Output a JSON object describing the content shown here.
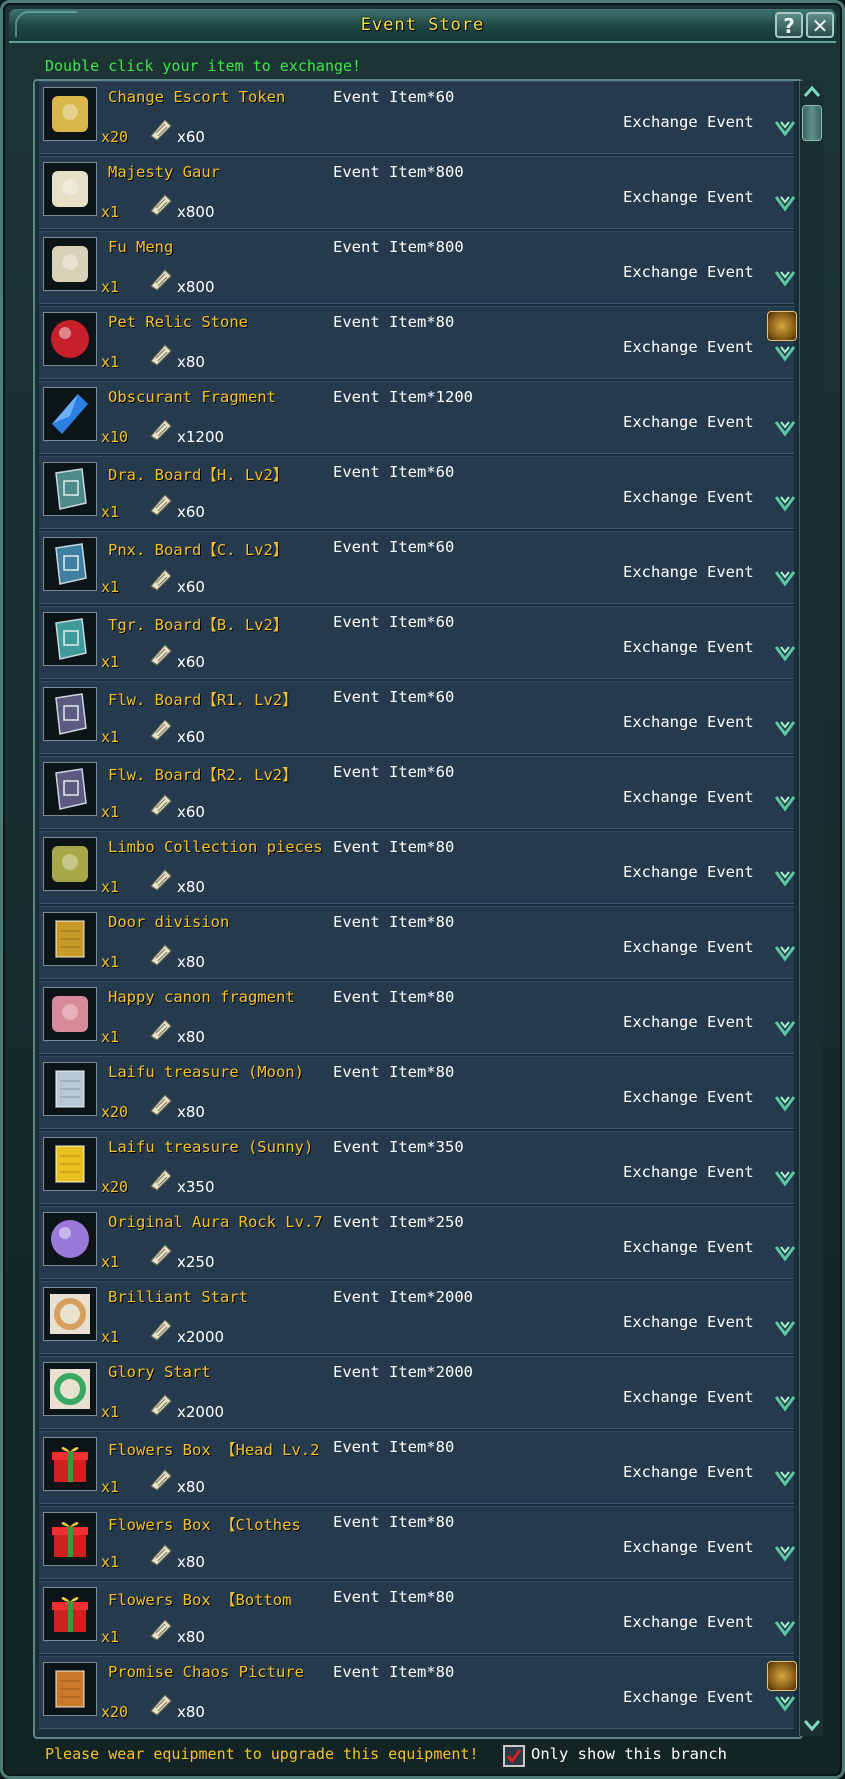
{
  "window": {
    "title": "Event Store",
    "help_label": "?",
    "close_label": "✕",
    "hint": "Double click your item to exchange!"
  },
  "items": [
    {
      "name": "Change Escort Token",
      "qty": "x20",
      "cost": "x60",
      "requirement": "Event Item*60",
      "exchange_label": "Exchange Event",
      "icon": "escort-token-icon",
      "color": "#d8b64a",
      "badge": false
    },
    {
      "name": "Majesty Gaur",
      "qty": "x1",
      "cost": "x800",
      "requirement": "Event Item*800",
      "exchange_label": "Exchange Event",
      "icon": "gaur-mount-icon",
      "color": "#e6e0c8",
      "badge": false
    },
    {
      "name": "Fu Meng",
      "qty": "x1",
      "cost": "x800",
      "requirement": "Event Item*800",
      "exchange_label": "Exchange Event",
      "icon": "fu-meng-mount-icon",
      "color": "#d9d2b8",
      "badge": false
    },
    {
      "name": "Pet Relic Stone",
      "qty": "x1",
      "cost": "x80",
      "requirement": "Event Item*80",
      "exchange_label": "Exchange Event",
      "icon": "relic-stone-icon",
      "color": "#c8202a",
      "badge": true
    },
    {
      "name": "Obscurant Fragment",
      "qty": "x10",
      "cost": "x1200",
      "requirement": "Event Item*1200",
      "exchange_label": "Exchange Event",
      "icon": "blue-crystal-icon",
      "color": "#2a7fe0",
      "badge": false
    },
    {
      "name": "Dra. Board【H. Lv2】",
      "qty": "x1",
      "cost": "x60",
      "requirement": "Event Item*60",
      "exchange_label": "Exchange Event",
      "icon": "dragon-board-icon",
      "color": "#4e8a8a",
      "badge": false
    },
    {
      "name": "Pnx. Board【C. Lv2】",
      "qty": "x1",
      "cost": "x60",
      "requirement": "Event Item*60",
      "exchange_label": "Exchange Event",
      "icon": "phoenix-board-icon",
      "color": "#3f7fa0",
      "badge": false
    },
    {
      "name": "Tgr. Board【B. Lv2】",
      "qty": "x1",
      "cost": "x60",
      "requirement": "Event Item*60",
      "exchange_label": "Exchange Event",
      "icon": "tiger-board-icon",
      "color": "#3f9a9a",
      "badge": false
    },
    {
      "name": "Flw. Board【R1. Lv2】",
      "qty": "x1",
      "cost": "x60",
      "requirement": "Event Item*60",
      "exchange_label": "Exchange Event",
      "icon": "flower-board-icon",
      "color": "#5c5a80",
      "badge": false
    },
    {
      "name": "Flw. Board【R2. Lv2】",
      "qty": "x1",
      "cost": "x60",
      "requirement": "Event Item*60",
      "exchange_label": "Exchange Event",
      "icon": "flower-board-icon",
      "color": "#5c5a80",
      "badge": false
    },
    {
      "name": "Limbo Collection pieces",
      "qty": "x1",
      "cost": "x80",
      "requirement": "Event Item*80",
      "exchange_label": "Exchange Event",
      "icon": "leaf-pieces-icon",
      "color": "#a8a84a",
      "badge": false
    },
    {
      "name": "Door division",
      "qty": "x1",
      "cost": "x80",
      "requirement": "Event Item*80",
      "exchange_label": "Exchange Event",
      "icon": "door-scroll-icon",
      "color": "#c89a2a",
      "badge": false
    },
    {
      "name": "Happy canon fragment",
      "qty": "x1",
      "cost": "x80",
      "requirement": "Event Item*80",
      "exchange_label": "Exchange Event",
      "icon": "pink-fragment-icon",
      "color": "#d88a9a",
      "badge": false
    },
    {
      "name": "Laifu treasure (Moon)",
      "qty": "x20",
      "cost": "x80",
      "requirement": "Event Item*80",
      "exchange_label": "Exchange Event",
      "icon": "moon-treasure-icon",
      "color": "#b8c8d8",
      "badge": false
    },
    {
      "name": "Laifu treasure (Sunny)",
      "qty": "x20",
      "cost": "x350",
      "requirement": "Event Item*350",
      "exchange_label": "Exchange Event",
      "icon": "sun-treasure-icon",
      "color": "#e8c020",
      "badge": false
    },
    {
      "name": "Original Aura Rock Lv.7",
      "qty": "x1",
      "cost": "x250",
      "requirement": "Event Item*250",
      "exchange_label": "Exchange Event",
      "icon": "aura-orb-icon",
      "color": "#9a7ad8",
      "badge": false
    },
    {
      "name": "Brilliant Start",
      "qty": "x1",
      "cost": "x2000",
      "requirement": "Event Item*2000",
      "exchange_label": "Exchange Event",
      "icon": "brilliant-ring-icon",
      "color": "#d8a060",
      "badge": false
    },
    {
      "name": "Glory Start",
      "qty": "x1",
      "cost": "x2000",
      "requirement": "Event Item*2000",
      "exchange_label": "Exchange Event",
      "icon": "glory-ring-icon",
      "color": "#3aa860",
      "badge": false
    },
    {
      "name": "Flowers Box 【Head Lv.2",
      "qty": "x1",
      "cost": "x80",
      "requirement": "Event Item*80",
      "exchange_label": "Exchange Event",
      "icon": "gift-box-icon",
      "color": "#d02020",
      "badge": false
    },
    {
      "name": "Flowers Box 【Clothes",
      "qty": "x1",
      "cost": "x80",
      "requirement": "Event Item*80",
      "exchange_label": "Exchange Event",
      "icon": "gift-box-icon",
      "color": "#d02020",
      "badge": false
    },
    {
      "name": "Flowers Box 【Bottom",
      "qty": "x1",
      "cost": "x80",
      "requirement": "Event Item*80",
      "exchange_label": "Exchange Event",
      "icon": "gift-box-icon",
      "color": "#d02020",
      "badge": false
    },
    {
      "name": "Promise Chaos Picture",
      "qty": "x20",
      "cost": "x80",
      "requirement": "Event Item*80",
      "exchange_label": "Exchange Event",
      "icon": "chaos-scroll-icon",
      "color": "#c87a2a",
      "badge": true
    }
  ],
  "footer": {
    "message": "Please wear equipment to upgrade this equipment!",
    "checkbox_label": "Only show this branch",
    "checkbox_checked": true
  },
  "colors": {
    "title": "#f3df4a",
    "hint": "#3ee64a",
    "item_name": "#f4c12e",
    "row_bg": "#253a4c",
    "exchange_icon": "#5cc8a0"
  }
}
